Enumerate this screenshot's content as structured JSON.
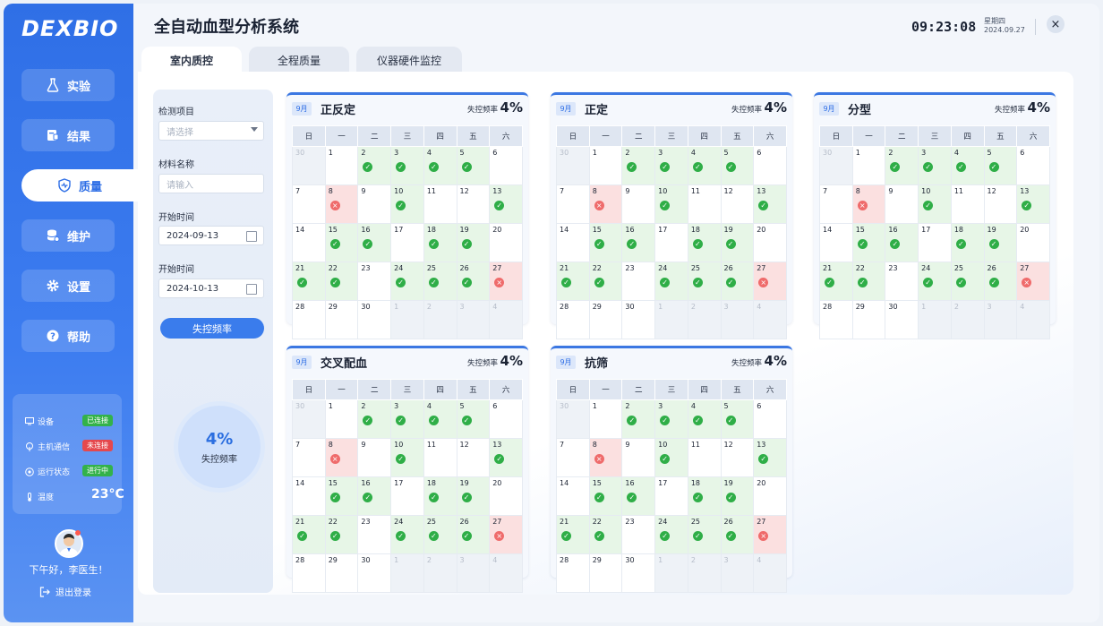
{
  "app": {
    "logo": "DEXBIO",
    "title": "全自动血型分析系统"
  },
  "header": {
    "time": "09:23:08",
    "weekday": "星期四",
    "date": "2024.09.27",
    "close_icon": "×"
  },
  "sidebar": {
    "items": [
      {
        "label": "实验",
        "icon": "flask-icon"
      },
      {
        "label": "结果",
        "icon": "result-icon"
      },
      {
        "label": "质量",
        "icon": "heart-shield-icon",
        "active": true
      },
      {
        "label": "维护",
        "icon": "database-icon"
      },
      {
        "label": "设置",
        "icon": "gear-icon"
      },
      {
        "label": "帮助",
        "icon": "help-icon"
      }
    ],
    "status": {
      "device": {
        "label": "设备",
        "badge": "已连接"
      },
      "host": {
        "label": "主机通信",
        "badge": "未连接"
      },
      "run": {
        "label": "运行状态",
        "badge": "进行中"
      },
      "temp": {
        "label": "温度",
        "value": "23°C"
      }
    },
    "greeting": "下午好，李医生！",
    "logout": "退出登录"
  },
  "tabs": [
    {
      "label": "室内质控",
      "active": true
    },
    {
      "label": "全程质量"
    },
    {
      "label": "仪器硬件监控"
    }
  ],
  "filters": {
    "item_label": "检测项目",
    "item_placeholder": "请选择",
    "material_label": "材料名称",
    "material_placeholder": "请输入",
    "start_label": "开始时间",
    "start_value": "2024-09-13",
    "end_label": "开始时间",
    "end_value": "2024-10-13",
    "button": "失控频率",
    "rate_value": "4%",
    "rate_label": "失控频率"
  },
  "calendar": {
    "weekdays": [
      "日",
      "一",
      "二",
      "三",
      "四",
      "五",
      "六"
    ],
    "rate_label": "失控频率",
    "cards": [
      {
        "month": "9月",
        "title": "正反定",
        "rate": "4%"
      },
      {
        "month": "9月",
        "title": "正定",
        "rate": "4%"
      },
      {
        "month": "9月",
        "title": "分型",
        "rate": "4%"
      },
      {
        "month": "9月",
        "title": "交叉配血",
        "rate": "4%"
      },
      {
        "month": "9月",
        "title": "抗筛",
        "rate": "4%"
      }
    ],
    "weeks": [
      [
        {
          "d": "30",
          "s": "out"
        },
        {
          "d": "1",
          "s": ""
        },
        {
          "d": "2",
          "s": "ok"
        },
        {
          "d": "3",
          "s": "ok"
        },
        {
          "d": "4",
          "s": "ok"
        },
        {
          "d": "5",
          "s": "ok"
        },
        {
          "d": "6",
          "s": ""
        }
      ],
      [
        {
          "d": "7",
          "s": ""
        },
        {
          "d": "8",
          "s": "fail"
        },
        {
          "d": "9",
          "s": ""
        },
        {
          "d": "10",
          "s": "ok"
        },
        {
          "d": "11",
          "s": ""
        },
        {
          "d": "12",
          "s": ""
        },
        {
          "d": "13",
          "s": "ok"
        }
      ],
      [
        {
          "d": "14",
          "s": ""
        },
        {
          "d": "15",
          "s": "ok"
        },
        {
          "d": "16",
          "s": "ok"
        },
        {
          "d": "17",
          "s": ""
        },
        {
          "d": "18",
          "s": "ok"
        },
        {
          "d": "19",
          "s": "ok"
        },
        {
          "d": "20",
          "s": ""
        }
      ],
      [
        {
          "d": "21",
          "s": "ok"
        },
        {
          "d": "22",
          "s": "ok"
        },
        {
          "d": "23",
          "s": ""
        },
        {
          "d": "24",
          "s": "ok"
        },
        {
          "d": "25",
          "s": "ok"
        },
        {
          "d": "26",
          "s": "ok"
        },
        {
          "d": "27",
          "s": "fail"
        }
      ],
      [
        {
          "d": "28",
          "s": ""
        },
        {
          "d": "29",
          "s": ""
        },
        {
          "d": "30",
          "s": ""
        },
        {
          "d": "1",
          "s": "out"
        },
        {
          "d": "2",
          "s": "out"
        },
        {
          "d": "3",
          "s": "out"
        },
        {
          "d": "4",
          "s": "out"
        }
      ]
    ]
  },
  "colors": {
    "primary": "#2f6fe6",
    "ok": "#2fae47",
    "fail": "#ef6b6b"
  }
}
